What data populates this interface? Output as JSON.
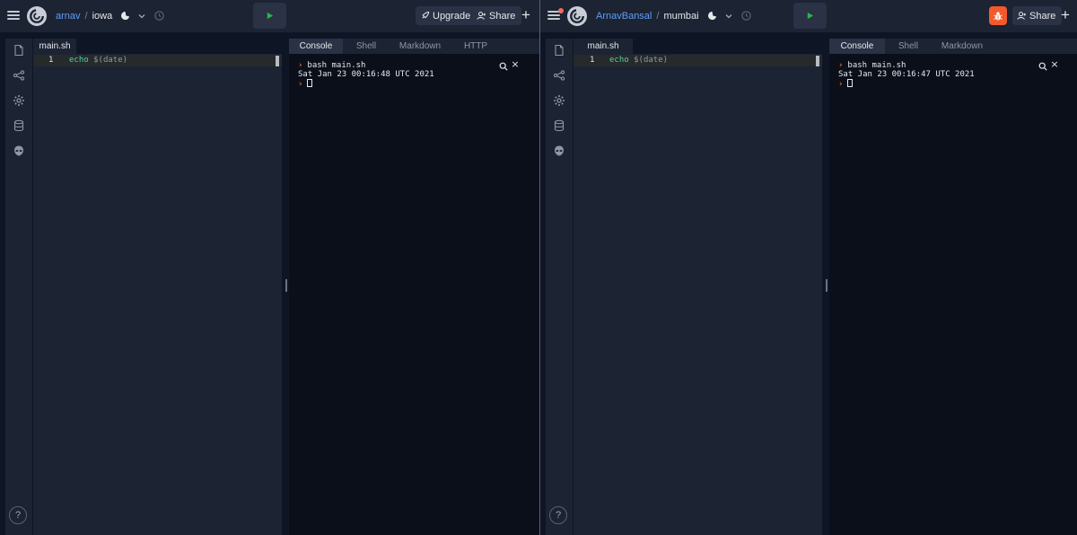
{
  "windows": [
    {
      "user": "arnav",
      "separator": "/",
      "repl": "iowa",
      "icons": [
        "menu-icon",
        "replit-logo-icon",
        "bash-language-icon",
        "chevron-down-icon",
        "history-icon",
        "run-icon"
      ],
      "upgrade_label": "Upgrade",
      "share_label": "Share",
      "plus_label": "+",
      "editor": {
        "filename": "main.sh",
        "line_number": "1",
        "code_keyword": "echo",
        "code_dollar": "$",
        "code_paren_open": "(",
        "code_inner": "date",
        "code_paren_close": ")"
      },
      "tabs": [
        "Console",
        "Shell",
        "Markdown",
        "HTTP"
      ],
      "console": {
        "command": "bash main.sh",
        "output": "Sat Jan 23 00:16:48 UTC 2021",
        "prompt": "›",
        "close": "×"
      },
      "help": "?"
    },
    {
      "user": "ArnavBansal",
      "separator": "/",
      "repl": "mumbai",
      "icons": [
        "menu-icon",
        "notification-dot",
        "replit-logo-icon",
        "bash-language-icon",
        "chevron-down-icon",
        "history-icon",
        "run-icon",
        "bug-icon"
      ],
      "share_label": "Share",
      "plus_label": "+",
      "editor": {
        "filename": "main.sh",
        "line_number": "1",
        "code_keyword": "echo",
        "code_dollar": "$",
        "code_paren_open": "(",
        "code_inner": "date",
        "code_paren_close": ")"
      },
      "tabs": [
        "Console",
        "Shell",
        "Markdown"
      ],
      "console": {
        "command": "bash main.sh",
        "output": "Sat Jan 23 00:16:47 UTC 2021",
        "prompt": "›",
        "close": "×"
      },
      "help": "?"
    }
  ],
  "colors": {
    "background": "#0e1525",
    "panel": "#1c2333",
    "accent_link": "#5d9ef8",
    "run_green": "#2fb34a",
    "prompt_orange": "#f26d3c",
    "bug_orange": "#f25a2c"
  }
}
